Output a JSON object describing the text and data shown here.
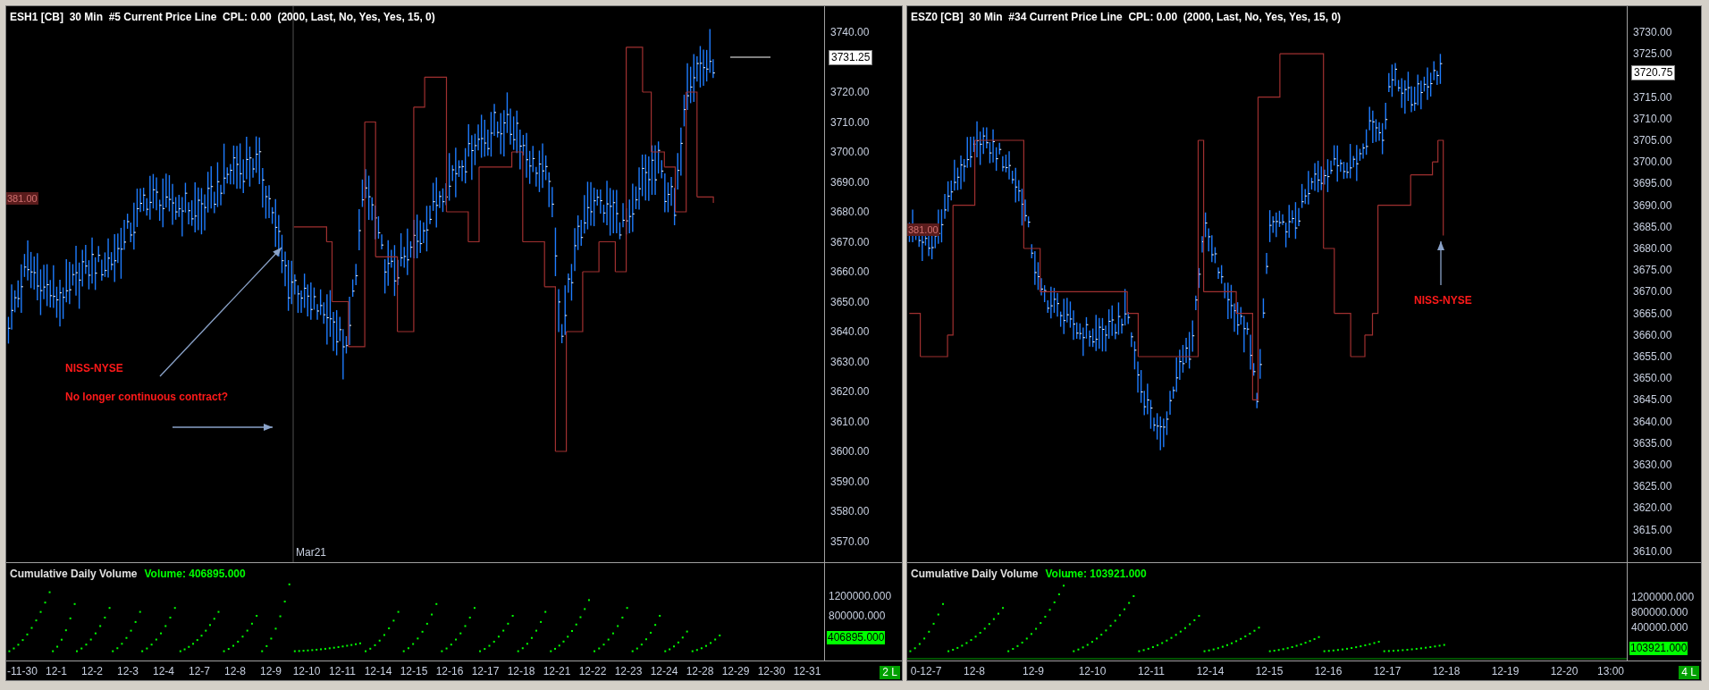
{
  "panels": [
    {
      "title": "ESH1 [CB]  30 Min  #5 Current Price Line  CPL: 0.00  (2000, Last, No, Yes, Yes, 15, 0)",
      "price_ticks": [
        "3740.00",
        "3720.00",
        "3710.00",
        "3700.00",
        "3690.00",
        "3680.00",
        "3670.00",
        "3660.00",
        "3650.00",
        "3640.00",
        "3630.00",
        "3620.00",
        "3610.00",
        "3600.00",
        "3590.00",
        "3580.00",
        "3570.00"
      ],
      "last_price": "3731.25",
      "marker_price": "381.00",
      "session_label": "Mar21",
      "notes": [
        "NISS-NYSE",
        "No longer continuous contract?"
      ],
      "volume": {
        "label": "Cumulative Daily Volume",
        "reading": "Volume: 406895.000",
        "ticks": [
          "1200000.000",
          "800000.000"
        ],
        "last": "406895.000"
      },
      "dates": [
        "-11-30",
        "12-1",
        "12-2",
        "12-3",
        "12-4",
        "12-7",
        "12-8",
        "12-9",
        "12-10",
        "12-11",
        "12-14",
        "12-15",
        "12-16",
        "12-17",
        "12-18",
        "12-21",
        "12-22",
        "12-23",
        "12-24",
        "12-28",
        "12-29",
        "12-30",
        "12-31"
      ],
      "status": "2 L"
    },
    {
      "title": "ESZ0 [CB]  30 Min  #34 Current Price Line  CPL: 0.00  (2000, Last, No, Yes, Yes, 15, 0)",
      "price_ticks": [
        "3730.00",
        "3725.00",
        "3715.00",
        "3710.00",
        "3705.00",
        "3700.00",
        "3695.00",
        "3690.00",
        "3685.00",
        "3680.00",
        "3675.00",
        "3670.00",
        "3665.00",
        "3660.00",
        "3655.00",
        "3650.00",
        "3645.00",
        "3640.00",
        "3635.00",
        "3630.00",
        "3625.00",
        "3620.00",
        "3615.00",
        "3610.00"
      ],
      "last_price": "3720.75",
      "marker_price": "381.00",
      "notes": [
        "NISS-NYSE"
      ],
      "volume": {
        "label": "Cumulative Daily Volume",
        "reading": "Volume: 103921.000",
        "ticks": [
          "1200000.000",
          "800000.000",
          "400000.000"
        ],
        "last": "103921.000"
      },
      "dates": [
        "0-12-7",
        "12-8",
        "12-9",
        "12-10",
        "12-11",
        "12-14",
        "12-15",
        "12-16",
        "12-17",
        "12-18",
        "12-19",
        "12-20",
        "13:00"
      ],
      "status": "4 L"
    }
  ]
}
